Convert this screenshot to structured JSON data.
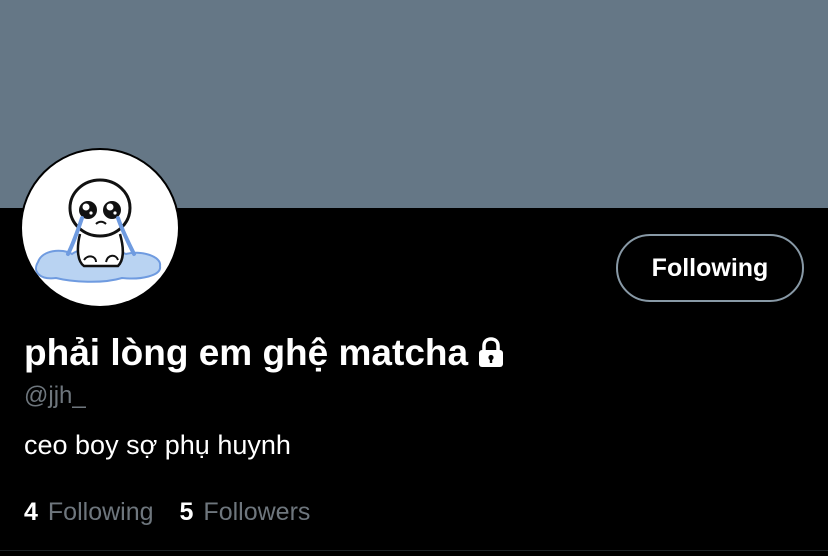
{
  "colors": {
    "banner": "#657786",
    "background": "#000000",
    "muted_text": "#6e767d",
    "button_border": "#8899a6",
    "divider": "#1d2226"
  },
  "profile": {
    "display_name": "phải lòng em ghệ matcha",
    "handle": "@jjh_",
    "bio": "ceo boy sợ phụ huynh",
    "lock_icon": "lock-icon",
    "follow_button_label": "Following"
  },
  "stats": {
    "following_count": "4",
    "following_label": "Following",
    "followers_count": "5",
    "followers_label": "Followers"
  }
}
